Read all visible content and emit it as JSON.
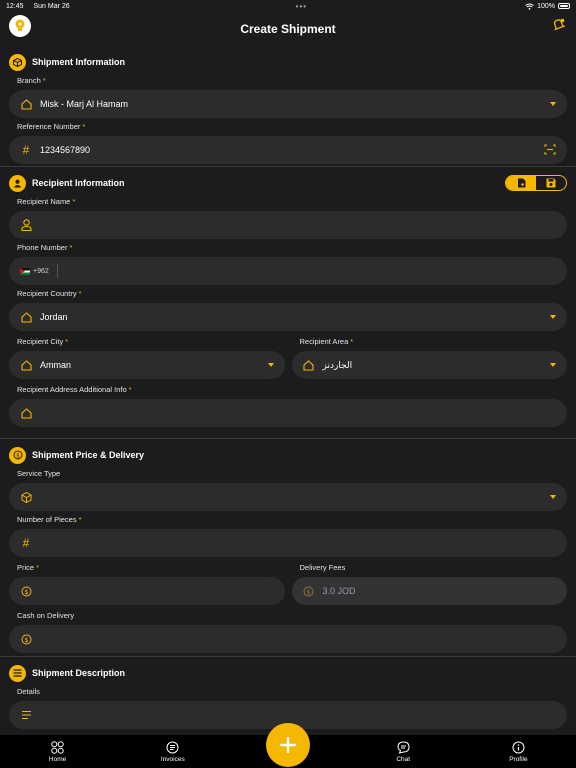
{
  "status": {
    "time": "12:45",
    "date": "Sun Mar 26",
    "battery": "100%"
  },
  "header": {
    "title": "Create Shipment"
  },
  "shipment_info": {
    "title": "Shipment Information",
    "branch_label": "Branch",
    "branch_value": "Misk - Marj Al Hamam",
    "reference_label": "Reference Number",
    "reference_value": "1234567890"
  },
  "recipient": {
    "title": "Recipient Information",
    "name_label": "Recipient Name",
    "phone_label": "Phone Number",
    "phone_code": "+962",
    "country_label": "Recipient Country",
    "country_value": "Jordan",
    "city_label": "Recipient City",
    "city_value": "Amman",
    "area_label": "Recipient Area",
    "area_value": "الجاردنز",
    "address_label": "Recipient Address Additional Info"
  },
  "price": {
    "title": "Shipment Price & Delivery",
    "service_label": "Service Type",
    "pieces_label": "Number of Pieces",
    "price_label": "Price",
    "fees_label": "Delivery Fees",
    "fees_value": "3.0 JOD",
    "cod_label": "Cash on Delivery"
  },
  "description": {
    "title": "Shipment Description",
    "details_label": "Details"
  },
  "required_mark": "*",
  "tabs": [
    {
      "label": "Home"
    },
    {
      "label": "Invoices"
    },
    {
      "label": "Chat"
    },
    {
      "label": "Profile"
    }
  ],
  "colors": {
    "accent": "#f5b700",
    "background": "#1c1c1e",
    "field": "#2c2c2e"
  }
}
